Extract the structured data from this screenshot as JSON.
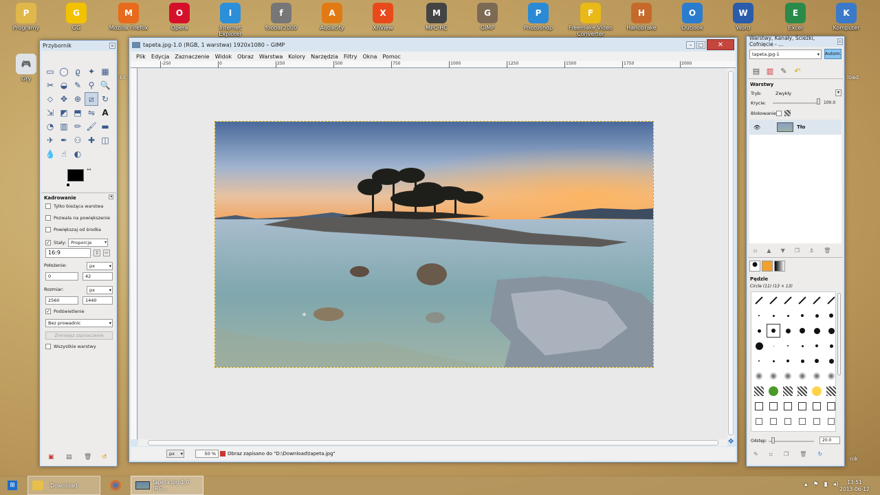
{
  "desktop": {
    "icons": [
      {
        "label": "Programy",
        "color": "#e0b84a",
        "glyph": "folder-icon"
      },
      {
        "label": "GG",
        "color": "#f2c200",
        "glyph": "gg-icon"
      },
      {
        "label": "Mozilla Firefox",
        "color": "#e86a1c",
        "glyph": "firefox-icon"
      },
      {
        "label": "Opera",
        "color": "#d5102a",
        "glyph": "opera-icon"
      },
      {
        "label": "Internet Explorer",
        "color": "#2b8fd9",
        "glyph": "ie-icon"
      },
      {
        "label": "foobar2000",
        "color": "#777777",
        "glyph": "foobar-icon"
      },
      {
        "label": "Audacity",
        "color": "#e27a14",
        "glyph": "audacity-icon"
      },
      {
        "label": "XnView",
        "color": "#e84a1c",
        "glyph": "xnview-icon"
      },
      {
        "label": "MPC-HC",
        "color": "#444444",
        "glyph": "mpc-icon"
      },
      {
        "label": "GIMP",
        "color": "#7d6a55",
        "glyph": "gimp-icon"
      },
      {
        "label": "Photoshop",
        "color": "#2a8ad6",
        "glyph": "photoshop-icon"
      },
      {
        "label": "Freemake Video Converter",
        "color": "#e9b917",
        "glyph": "freemake-icon"
      },
      {
        "label": "Handbrake",
        "color": "#c56a2a",
        "glyph": "handbrake-icon"
      },
      {
        "label": "Outlook",
        "color": "#2a7ccf",
        "glyph": "outlook-icon"
      },
      {
        "label": "Word",
        "color": "#2a5cab",
        "glyph": "word-icon"
      },
      {
        "label": "Excel",
        "color": "#2a8a4a",
        "glyph": "excel-icon"
      },
      {
        "label": "Komputer",
        "color": "#3a7ac8",
        "glyph": "computer-icon"
      }
    ],
    "gry_label": "Gry",
    "right_label_1": "load",
    "right_label_2": "nik",
    "left_cut_label": "ks"
  },
  "toolbox": {
    "title": "Przybornik",
    "tool_options_title": "Kadrowanie",
    "opt_current_layer": "Tylko bieżąca warstwa",
    "opt_allow_growing": "Pozwala na powiększenie",
    "opt_expand_center": "Powiększaj od środka",
    "opt_fixed": "Stały:",
    "fixed_mode": "Proporcje",
    "ratio": "16:9",
    "position_label": "Położenie:",
    "position_unit": "px",
    "pos_x": "0",
    "pos_y": "42",
    "size_label": "Rozmiar:",
    "size_unit": "px",
    "size_w": "2560",
    "size_h": "1440",
    "highlight": "Podświetlenie",
    "guides": "Bez prowadnic",
    "shrink_button": "Zmniejsz zaznaczenie",
    "all_layers": "Wszystkie warstwy"
  },
  "gimp": {
    "title": "tapeta.jpg-1.0 (RGB, 1 warstwa) 1920x1080 – GIMP",
    "menu": [
      "Plik",
      "Edycja",
      "Zaznaczenie",
      "Widok",
      "Obraz",
      "Warstwa",
      "Kolory",
      "Narzędzia",
      "Filtry",
      "Okna",
      "Pomoc"
    ],
    "ruler_labels": [
      "-250",
      "0",
      "250",
      "500",
      "750",
      "1000",
      "1250",
      "1500",
      "1750",
      "2000"
    ],
    "status_unit": "px",
    "zoom": "50 %",
    "status_message": "Obraz zapisano do \"D:\\Download\\tapeta.jpg\""
  },
  "layers": {
    "title": "Warstwy, Kanały, Ścieżki, Cofnięcie - ...",
    "image_select": "tapeta.jpg-1",
    "auto_button": "Autom.",
    "panel_title": "Warstwy",
    "mode_label": "Tryb:",
    "mode_value": "Zwykły",
    "opacity_label": "Krycie:",
    "opacity_value": "100.0",
    "lock_label": "Blokowanie:",
    "layer_name": "Tło",
    "brushes_title": "Pędzle",
    "brush_name": "Circle (11) (13 × 13)",
    "spacing_label": "Odstęp:",
    "spacing_value": "20.0"
  },
  "taskbar": {
    "download_label": "Download",
    "gimp_task_label": "tapeta.jpg-1.0 (RG...",
    "time": "13:51",
    "date": "2013-06-12"
  }
}
